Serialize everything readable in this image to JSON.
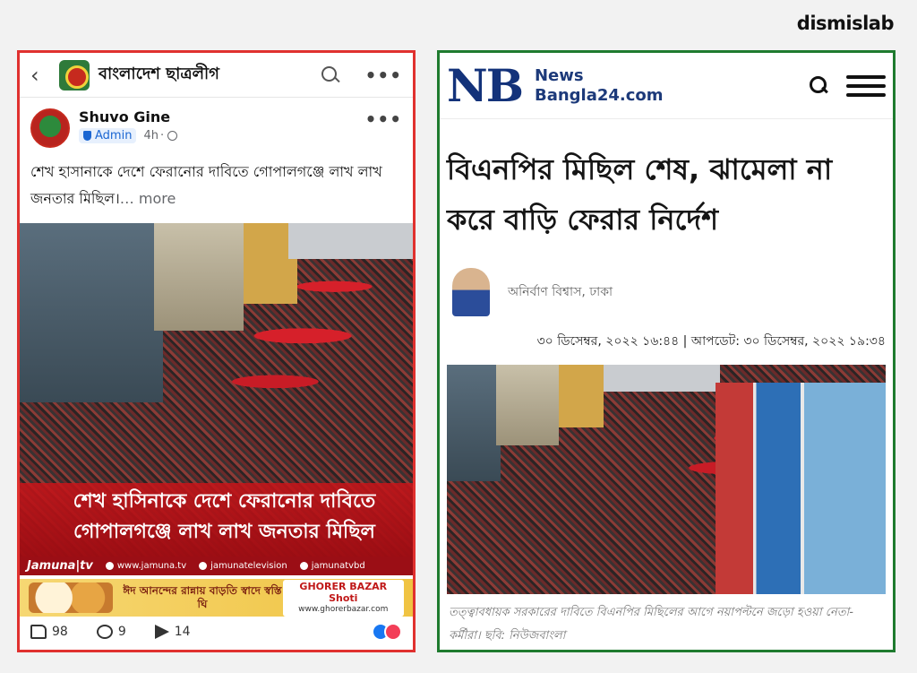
{
  "watermark": "dismislab",
  "facebook_post": {
    "header": {
      "back_icon": "‹",
      "group_name": "বাংলাদেশ ছাত্রলীগ",
      "more_icon": "•••"
    },
    "author": {
      "name": "Shuvo Gine",
      "badge": "Admin",
      "time": "4h",
      "more_icon": "•••"
    },
    "text": "শেখ হাসানাকে দেশে ফেরানোর দাবিতে গোপালগঞ্জে লাখ লাখ জনতার মিছিল।",
    "more_label": "… more",
    "image": {
      "overlay_line1": "শেখ হাসিনাকে দেশে ফেরানোর দাবিতে",
      "overlay_line2": "গোপালগঞ্জে লাখ লাখ জনতার মিছিল",
      "channel": "Jamuna|tv",
      "website": "www.jamuna.tv",
      "facebook": "jamunatelevision",
      "youtube": "jamunatvbd",
      "ad_text": "ঈদ আনন্দের রান্নায় বাড়তি স্বাদে স্বস্তি ঘি",
      "ad_brand1": "GHORER BAZAR",
      "ad_brand2": "Shoti",
      "ad_site": "www.ghorerbazar.com"
    },
    "actions": {
      "likes": "98",
      "comments": "9",
      "shares": "14"
    }
  },
  "news_article": {
    "logo": "NB",
    "site_line1": "News",
    "site_line2": "Bangla24.com",
    "title": "বিএনপির মিছিল শেষ, ঝামেলা না করে বাড়ি ফেরার নির্দেশ",
    "author": "অনির্বাণ বিশ্বাস, ঢাকা",
    "timestamp": "৩০ ডিসেম্বর, ২০২২ ১৬:৪৪ | আপডেট: ৩০ ডিসেম্বর, ২০২২ ১৯:৩৪",
    "caption": "তত্ত্বাবধায়ক সরকারের দাবিতে বিএনপির মিছিলের আগে নয়াপল্টনে জড়ো হওয়া নেতা-কর্মীরা। ছবি: নিউজবাংলা"
  },
  "colors": {
    "left_border": "#e0312f",
    "right_border": "#1f7b2f",
    "nb_blue": "#13327a"
  }
}
